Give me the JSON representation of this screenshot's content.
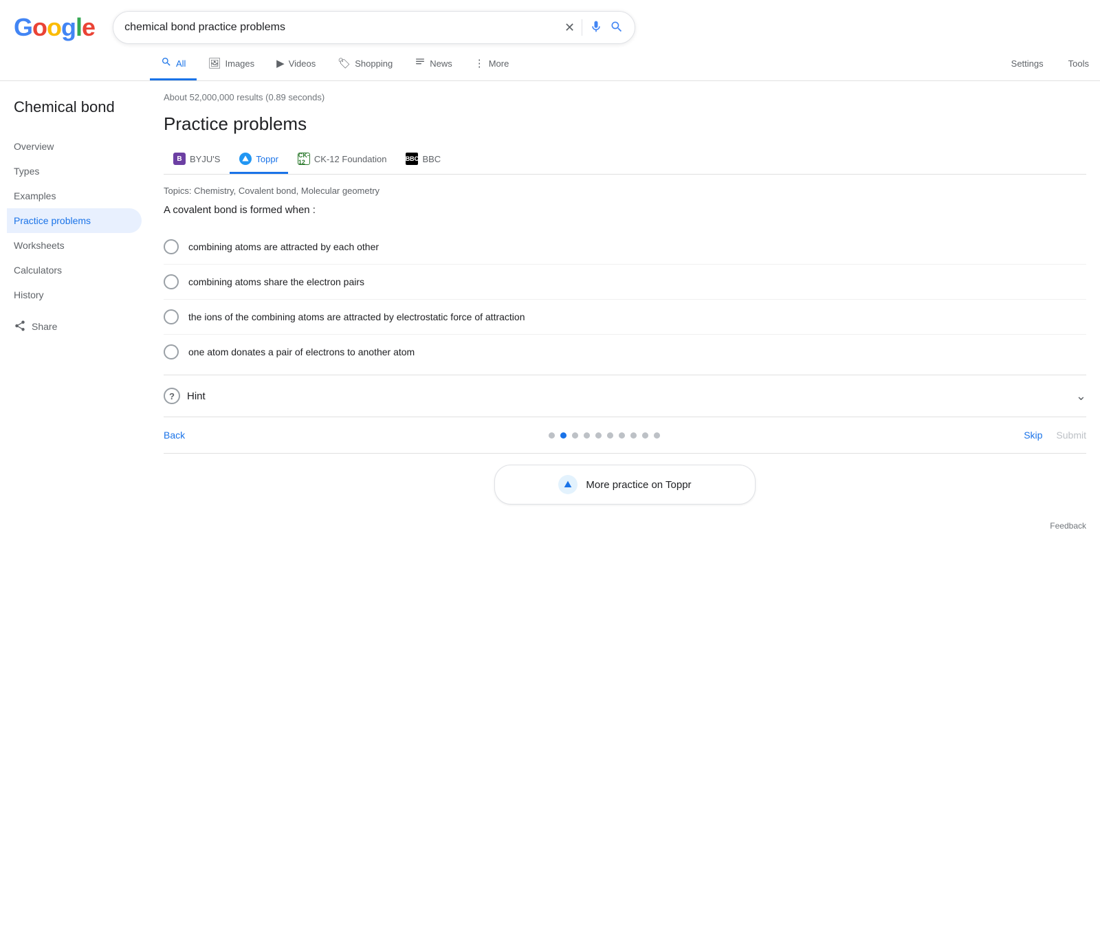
{
  "logo": {
    "letters": [
      {
        "char": "G",
        "class": "logo-G"
      },
      {
        "char": "o",
        "class": "logo-o1"
      },
      {
        "char": "o",
        "class": "logo-o2"
      },
      {
        "char": "g",
        "class": "logo-g"
      },
      {
        "char": "l",
        "class": "logo-l"
      },
      {
        "char": "e",
        "class": "logo-e"
      }
    ]
  },
  "search": {
    "query": "chemical bond practice problems",
    "placeholder": "Search"
  },
  "nav_tabs": [
    {
      "id": "all",
      "label": "All",
      "icon": "🔍",
      "active": true
    },
    {
      "id": "images",
      "label": "Images",
      "icon": "🖼"
    },
    {
      "id": "videos",
      "label": "Videos",
      "icon": "▶"
    },
    {
      "id": "shopping",
      "label": "Shopping",
      "icon": "🏷"
    },
    {
      "id": "news",
      "label": "News",
      "icon": "📰"
    },
    {
      "id": "more",
      "label": "More",
      "icon": "⋮"
    }
  ],
  "nav_settings": [
    {
      "id": "settings",
      "label": "Settings"
    },
    {
      "id": "tools",
      "label": "Tools"
    }
  ],
  "results_count": "About 52,000,000 results (0.89 seconds)",
  "sidebar": {
    "title": "Chemical bond",
    "items": [
      {
        "id": "overview",
        "label": "Overview",
        "active": false
      },
      {
        "id": "types",
        "label": "Types",
        "active": false
      },
      {
        "id": "examples",
        "label": "Examples",
        "active": false
      },
      {
        "id": "practice-problems",
        "label": "Practice problems",
        "active": true
      },
      {
        "id": "worksheets",
        "label": "Worksheets",
        "active": false
      },
      {
        "id": "calculators",
        "label": "Calculators",
        "active": false
      },
      {
        "id": "history",
        "label": "History",
        "active": false
      }
    ],
    "share_label": "Share"
  },
  "section": {
    "title": "Practice problems",
    "sources": [
      {
        "id": "byjus",
        "label": "BYJU'S",
        "icon_type": "byju"
      },
      {
        "id": "toppr",
        "label": "Toppr",
        "icon_type": "toppr",
        "active": true
      },
      {
        "id": "ck12",
        "label": "CK-12 Foundation",
        "icon_type": "ck12"
      },
      {
        "id": "bbc",
        "label": "BBC",
        "icon_type": "bbc"
      }
    ],
    "topics": "Topics: Chemistry, Covalent bond, Molecular geometry",
    "question": "A covalent bond is formed when :",
    "options": [
      {
        "id": "opt1",
        "text": "combining atoms are attracted by each other"
      },
      {
        "id": "opt2",
        "text": "combining atoms share the electron pairs"
      },
      {
        "id": "opt3",
        "text": "the ions of the combining atoms are attracted by electrostatic force of attraction"
      },
      {
        "id": "opt4",
        "text": "one atom donates a pair of electrons to another atom"
      }
    ],
    "hint_label": "Hint",
    "hint_icon": "?",
    "back_label": "Back",
    "skip_label": "Skip",
    "submit_label": "Submit",
    "dots_total": 10,
    "dots_active_index": 1,
    "more_practice_label": "More practice on Toppr"
  },
  "feedback": {
    "label": "Feedback"
  }
}
